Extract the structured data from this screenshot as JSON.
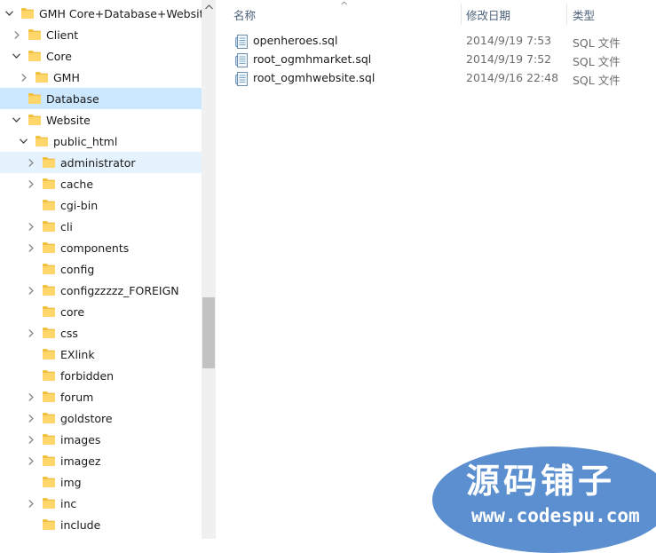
{
  "tree": [
    {
      "label": "GMH Core+Database+Website",
      "depth": 0,
      "expander": "expanded",
      "state": ""
    },
    {
      "label": "Client",
      "depth": 1,
      "expander": "collapsed",
      "state": ""
    },
    {
      "label": "Core",
      "depth": 1,
      "expander": "expanded",
      "state": ""
    },
    {
      "label": "GMH",
      "depth": 2,
      "expander": "collapsed",
      "state": ""
    },
    {
      "label": "Database",
      "depth": 1,
      "expander": "none",
      "state": "selected"
    },
    {
      "label": "Website",
      "depth": 1,
      "expander": "expanded",
      "state": ""
    },
    {
      "label": "public_html",
      "depth": 2,
      "expander": "expanded",
      "state": ""
    },
    {
      "label": "administrator",
      "depth": 3,
      "expander": "collapsed",
      "state": "hovered"
    },
    {
      "label": "cache",
      "depth": 3,
      "expander": "collapsed",
      "state": ""
    },
    {
      "label": "cgi-bin",
      "depth": 3,
      "expander": "none",
      "state": ""
    },
    {
      "label": "cli",
      "depth": 3,
      "expander": "collapsed",
      "state": ""
    },
    {
      "label": "components",
      "depth": 3,
      "expander": "collapsed",
      "state": ""
    },
    {
      "label": "config",
      "depth": 3,
      "expander": "none",
      "state": ""
    },
    {
      "label": "configzzzzz_FOREIGN",
      "depth": 3,
      "expander": "collapsed",
      "state": ""
    },
    {
      "label": "core",
      "depth": 3,
      "expander": "none",
      "state": ""
    },
    {
      "label": "css",
      "depth": 3,
      "expander": "collapsed",
      "state": ""
    },
    {
      "label": "EXlink",
      "depth": 3,
      "expander": "none",
      "state": ""
    },
    {
      "label": "forbidden",
      "depth": 3,
      "expander": "none",
      "state": ""
    },
    {
      "label": "forum",
      "depth": 3,
      "expander": "collapsed",
      "state": ""
    },
    {
      "label": "goldstore",
      "depth": 3,
      "expander": "collapsed",
      "state": ""
    },
    {
      "label": "images",
      "depth": 3,
      "expander": "collapsed",
      "state": ""
    },
    {
      "label": "imagez",
      "depth": 3,
      "expander": "collapsed",
      "state": ""
    },
    {
      "label": "img",
      "depth": 3,
      "expander": "none",
      "state": ""
    },
    {
      "label": "inc",
      "depth": 3,
      "expander": "collapsed",
      "state": ""
    },
    {
      "label": "include",
      "depth": 3,
      "expander": "none",
      "state": ""
    }
  ],
  "columns": {
    "name": "名称",
    "date": "修改日期",
    "type": "类型",
    "sort_indicator": "^"
  },
  "files": [
    {
      "name": "openheroes.sql",
      "date": "2014/9/19 7:53",
      "type": "SQL 文件"
    },
    {
      "name": "root_ogmhmarket.sql",
      "date": "2014/9/19 7:52",
      "type": "SQL 文件"
    },
    {
      "name": "root_ogmhwebsite.sql",
      "date": "2014/9/16 22:48",
      "type": "SQL 文件"
    }
  ],
  "watermark": {
    "title": "源码铺子",
    "url": "www.codespu.com"
  },
  "colors": {
    "folder": "#ffd66a",
    "folder_dark": "#f4c043",
    "selected": "#cce8ff",
    "hover": "#e5f3ff",
    "header_text": "#4c607a",
    "watermark": "#5b8fcf"
  },
  "icons": {
    "expanded": "chevron-down-icon",
    "collapsed": "chevron-right-icon",
    "folder": "folder-icon",
    "file": "sql-file-icon",
    "scroll_up": "scroll-up-arrow-icon"
  }
}
